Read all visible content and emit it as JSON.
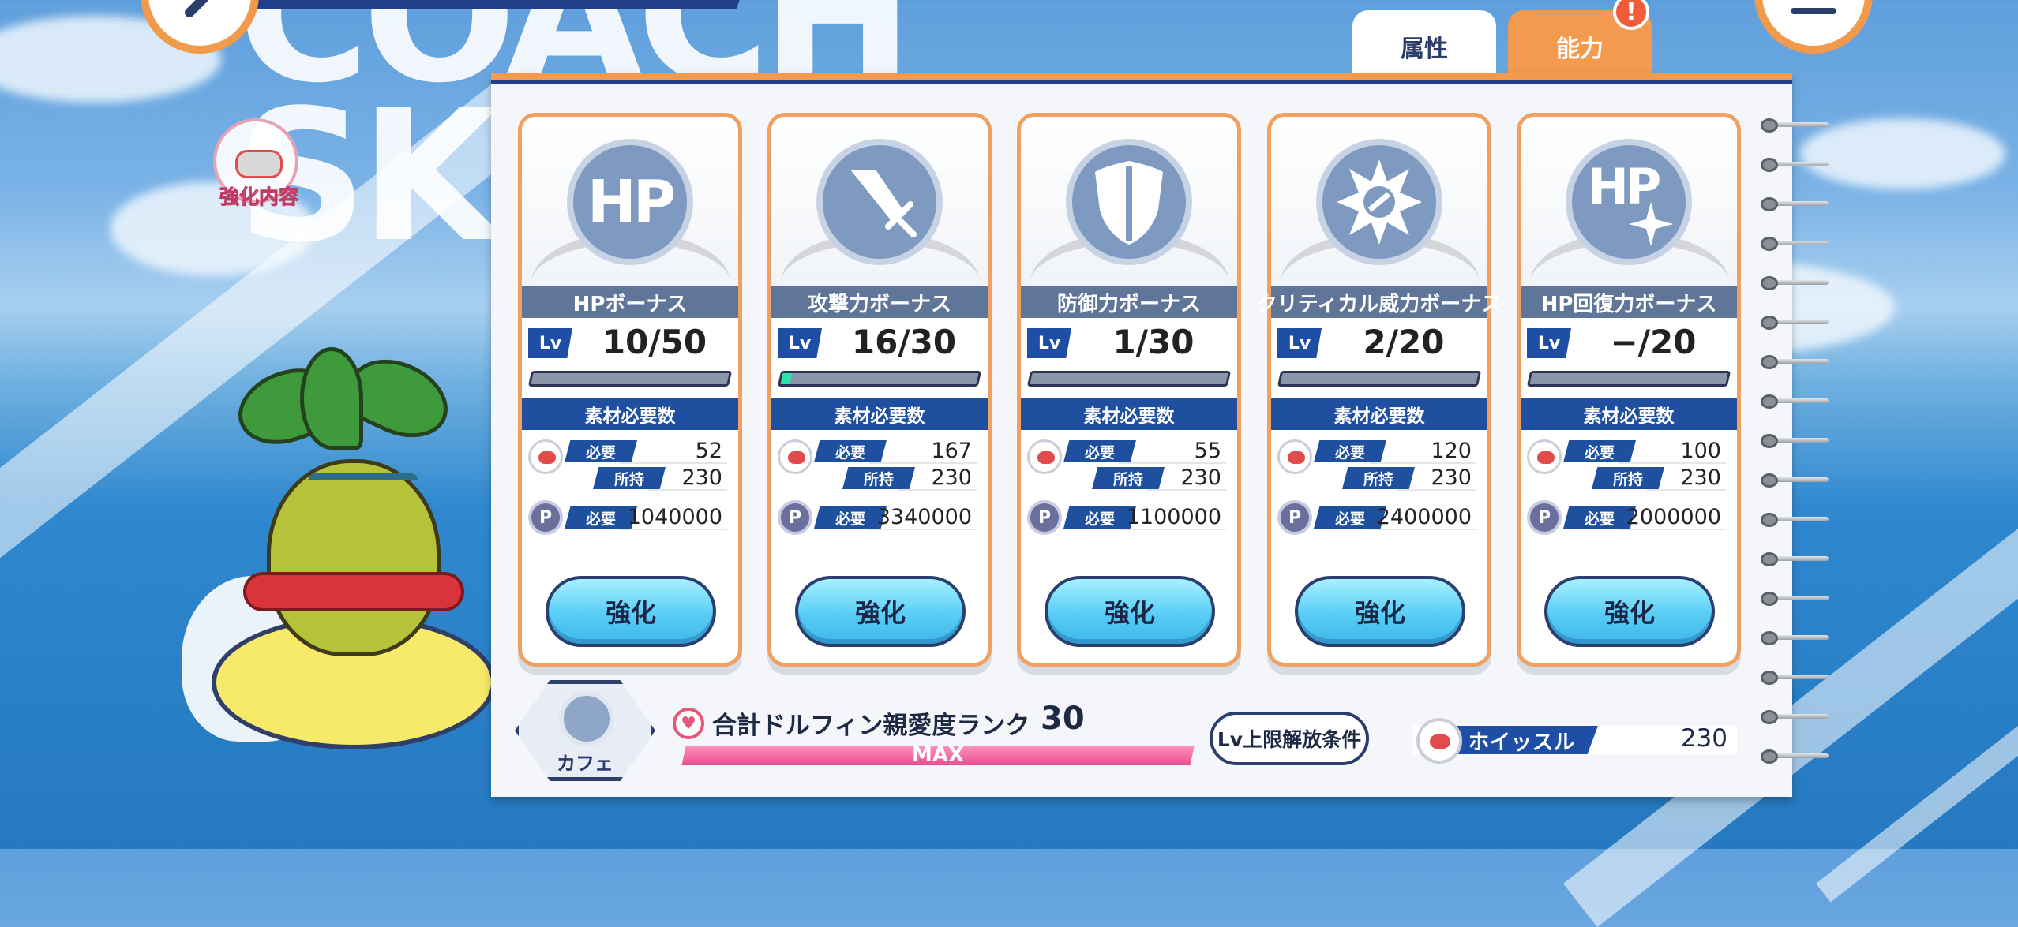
{
  "background_text": {
    "line1": "COACH",
    "line2": "SK"
  },
  "tabs": [
    {
      "label": "属性",
      "active": false
    },
    {
      "label": "能力",
      "active": true
    }
  ],
  "notification_badge": "!",
  "left_panel": {
    "enhance_content_label": "強化内容"
  },
  "cards": [
    {
      "icon": "hp-icon",
      "icon_text": "HP",
      "title": "HPボーナス",
      "lv_tag": "Lv",
      "level": "10/50",
      "progress": 0.0,
      "materials_header": "素材必要数",
      "whistle_required_label": "必要",
      "whistle_required": "52",
      "whistle_owned_label": "所持",
      "whistle_owned": "230",
      "coin_label": "必要",
      "coin_required": "1040000",
      "button": "強化"
    },
    {
      "icon": "sword-icon",
      "icon_text": "",
      "title": "攻撃力ボーナス",
      "lv_tag": "Lv",
      "level": "16/30",
      "progress": 0.05,
      "materials_header": "素材必要数",
      "whistle_required_label": "必要",
      "whistle_required": "167",
      "whistle_owned_label": "所持",
      "whistle_owned": "230",
      "coin_label": "必要",
      "coin_required": "3340000",
      "button": "強化"
    },
    {
      "icon": "shield-icon",
      "icon_text": "",
      "title": "防御力ボーナス",
      "lv_tag": "Lv",
      "level": "1/30",
      "progress": 0.0,
      "materials_header": "素材必要数",
      "whistle_required_label": "必要",
      "whistle_required": "55",
      "whistle_owned_label": "所持",
      "whistle_owned": "230",
      "coin_label": "必要",
      "coin_required": "1100000",
      "button": "強化"
    },
    {
      "icon": "critical-burst-icon",
      "icon_text": "",
      "title": "クリティカル威力ボーナス",
      "lv_tag": "Lv",
      "level": "2/20",
      "progress": 0.0,
      "materials_header": "素材必要数",
      "whistle_required_label": "必要",
      "whistle_required": "120",
      "whistle_owned_label": "所持",
      "whistle_owned": "230",
      "coin_label": "必要",
      "coin_required": "2400000",
      "button": "強化"
    },
    {
      "icon": "hp-recovery-icon",
      "icon_text": "HP",
      "title": "HP回復力ボーナス",
      "lv_tag": "Lv",
      "level": "−/20",
      "progress": 0.0,
      "materials_header": "素材必要数",
      "whistle_required_label": "必要",
      "whistle_required": "100",
      "whistle_owned_label": "所持",
      "whistle_owned": "230",
      "coin_label": "必要",
      "coin_required": "2000000",
      "button": "強化"
    }
  ],
  "bottom": {
    "cafe_label": "カフェ",
    "rank_label": "合計ドルフィン親愛度ランク",
    "rank_value": "30",
    "rank_bar_text": "MAX",
    "lv_limit_button": "Lv上限解放条件",
    "whistle_label": "ホイッスル",
    "whistle_value": "230"
  },
  "colors": {
    "accent_orange": "#f39a4f",
    "navy": "#1f4fa5",
    "button_cyan": "#58cdf6",
    "pink": "#e84f8f"
  }
}
